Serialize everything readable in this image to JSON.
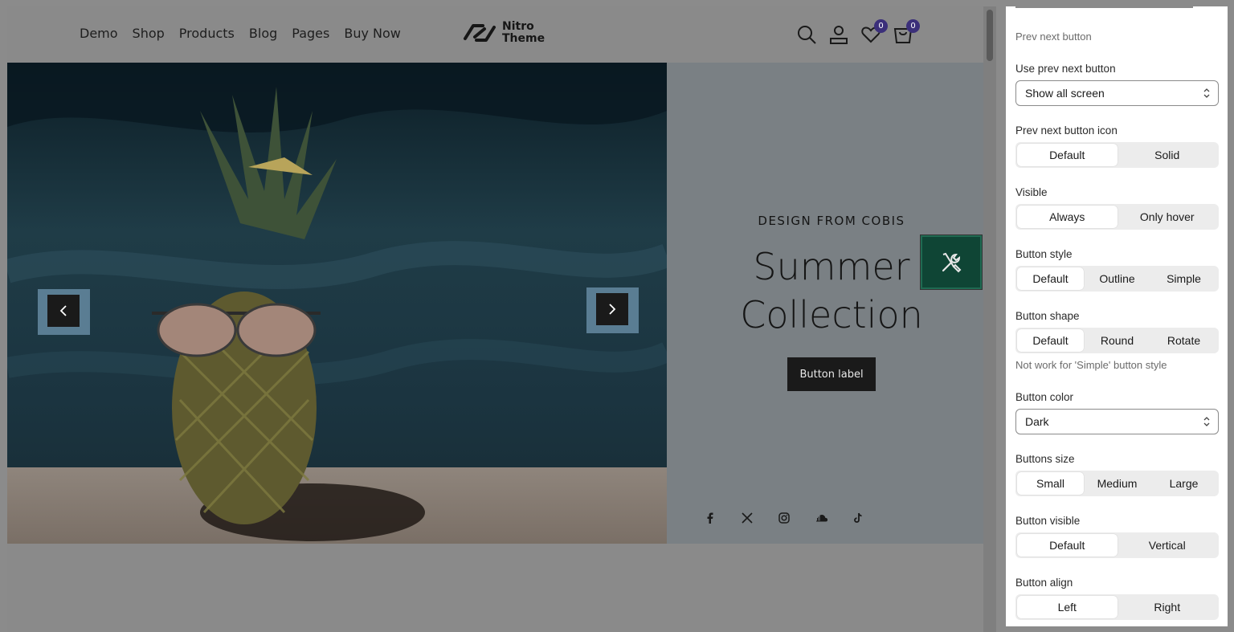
{
  "header": {
    "nav": [
      "Demo",
      "Shop",
      "Products",
      "Blog",
      "Pages",
      "Buy Now"
    ],
    "logo_line1": "Nitro",
    "logo_line2": "Theme",
    "wishlist_count": "0",
    "cart_count": "0"
  },
  "hero": {
    "eyebrow": "DESIGN FROM COBIS",
    "title_line1": "Summer",
    "title_line2": "Collection",
    "button_label": "Button label",
    "socials": [
      "facebook-icon",
      "x-icon",
      "instagram-icon",
      "soundcloud-icon",
      "tiktok-icon"
    ]
  },
  "panel": {
    "section_title": "Prev next button",
    "use_prev_next": {
      "label": "Use prev next button",
      "value": "Show all screen"
    },
    "prev_next_icon": {
      "label": "Prev next button icon",
      "options": [
        "Default",
        "Solid"
      ],
      "selected": "Default"
    },
    "visible": {
      "label": "Visible",
      "options": [
        "Always",
        "Only hover"
      ],
      "selected": "Always"
    },
    "button_style": {
      "label": "Button style",
      "options": [
        "Default",
        "Outline",
        "Simple"
      ],
      "selected": "Default"
    },
    "button_shape": {
      "label": "Button shape",
      "options": [
        "Default",
        "Round",
        "Rotate"
      ],
      "selected": "Default",
      "help": "Not work for 'Simple' button style"
    },
    "button_color": {
      "label": "Button color",
      "value": "Dark"
    },
    "buttons_size": {
      "label": "Buttons size",
      "options": [
        "Small",
        "Medium",
        "Large"
      ],
      "selected": "Small"
    },
    "button_visible": {
      "label": "Button visible",
      "options": [
        "Default",
        "Vertical"
      ],
      "selected": "Default"
    },
    "button_align": {
      "label": "Button align",
      "options": [
        "Left",
        "Right"
      ],
      "selected": "Left"
    }
  },
  "colors": {
    "tool_button": "#0f4535",
    "badge": "#3b2f7a"
  }
}
